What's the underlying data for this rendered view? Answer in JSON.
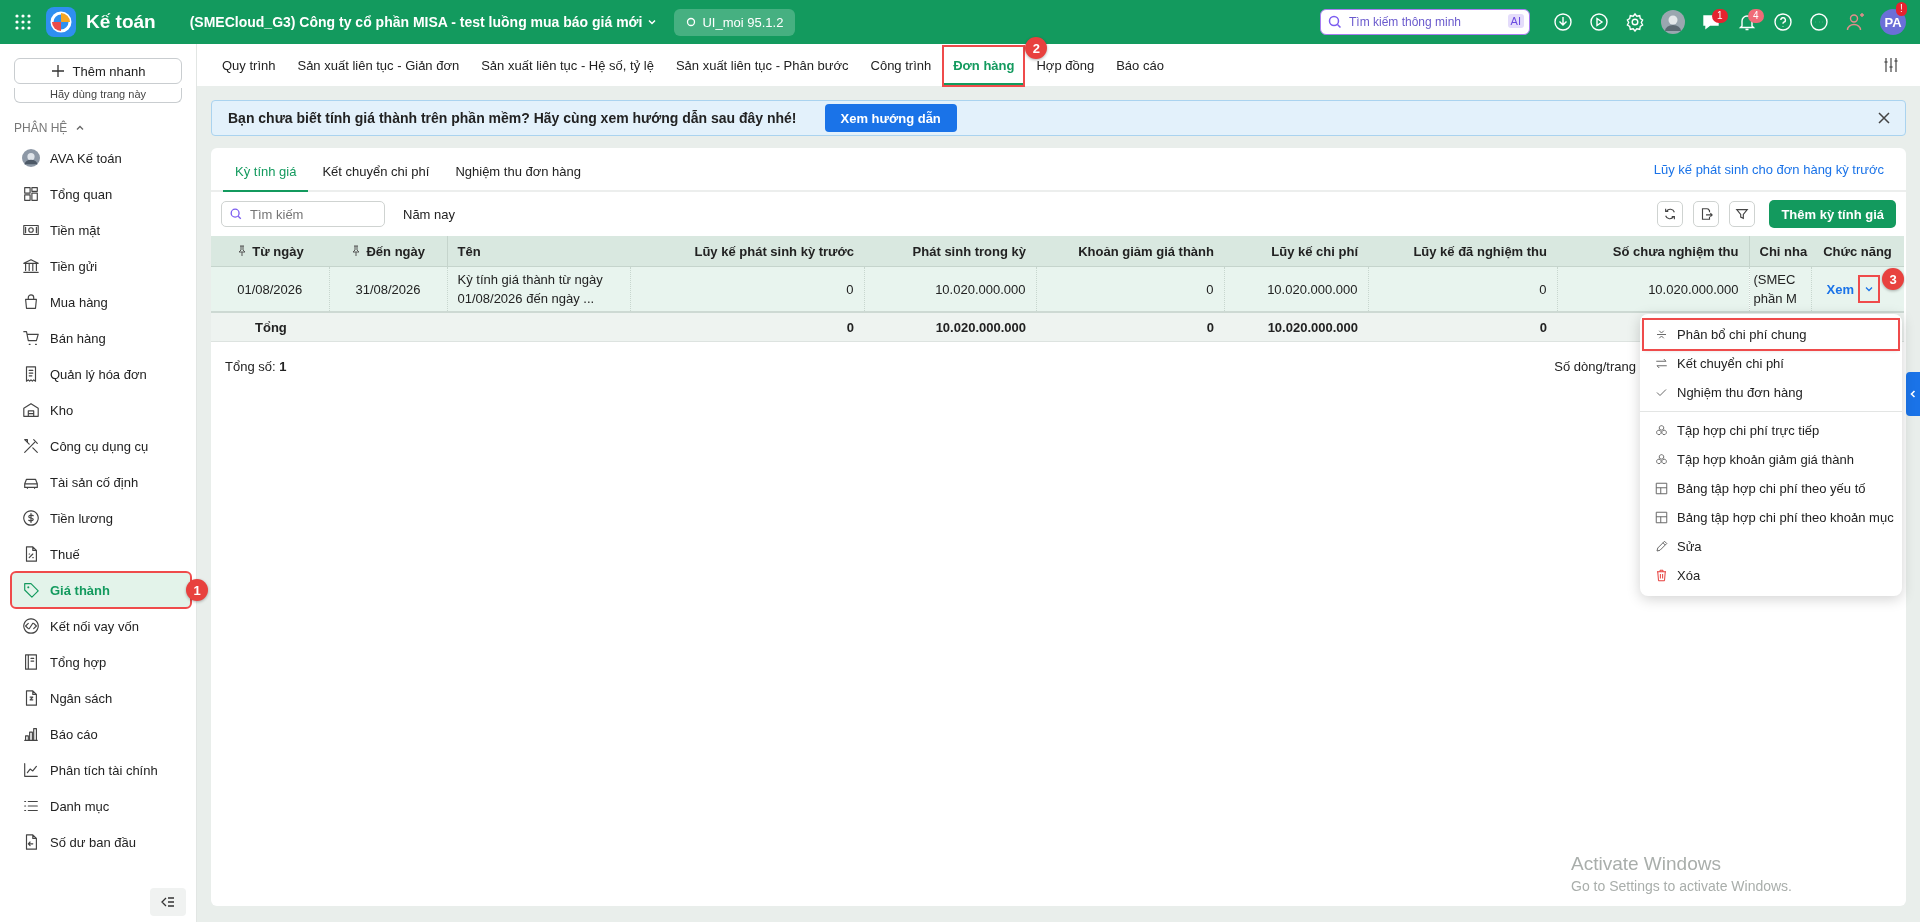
{
  "topbar": {
    "app_name": "Kế toán",
    "company": "(SMECloud_G3) Công ty cổ phần MISA - test luồng mua báo giá mới",
    "version": "UI_moi 95.1.2",
    "search": {
      "placeholder": "Tìm kiếm thông minh",
      "badge": "AI"
    },
    "chat_count": "1",
    "notification_count": "4",
    "user_initials": "PA",
    "user_alert": "!"
  },
  "sidebar": {
    "quick_add": "Thêm nhanh",
    "hint_card": "Hãy dùng trang này",
    "section": {
      "label": "PHÂN HỆ",
      "expanded": true
    },
    "items": [
      {
        "label": "AVA Kế toán",
        "selected": false
      },
      {
        "label": "Tổng quan",
        "selected": false
      },
      {
        "label": "Tiền mặt",
        "selected": false
      },
      {
        "label": "Tiền gửi",
        "selected": false
      },
      {
        "label": "Mua hàng",
        "selected": false
      },
      {
        "label": "Bán hàng",
        "selected": false
      },
      {
        "label": "Quản lý hóa đơn",
        "selected": false
      },
      {
        "label": "Kho",
        "selected": false
      },
      {
        "label": "Công cụ dụng cụ",
        "selected": false
      },
      {
        "label": "Tài sản cố định",
        "selected": false
      },
      {
        "label": "Tiền lương",
        "selected": false
      },
      {
        "label": "Thuế",
        "selected": false
      },
      {
        "label": "Giá thành",
        "selected": true,
        "highlighted": true,
        "callout": "1"
      },
      {
        "label": "Kết nối vay vốn",
        "selected": false
      },
      {
        "label": "Tổng hợp",
        "selected": false
      },
      {
        "label": "Ngân sách",
        "selected": false
      },
      {
        "label": "Báo cáo",
        "selected": false
      },
      {
        "label": "Phân tích tài chính",
        "selected": false
      },
      {
        "label": "Danh mục",
        "selected": false
      },
      {
        "label": "Số dư ban đầu",
        "selected": false
      }
    ]
  },
  "tabs": [
    {
      "label": "Quy trình",
      "selected": false
    },
    {
      "label": "Sản xuất liên tục - Giản đơn",
      "selected": false
    },
    {
      "label": "Sản xuất liên tục - Hệ số, tỷ lệ",
      "selected": false
    },
    {
      "label": "Sản xuất liên tục - Phân bước",
      "selected": false
    },
    {
      "label": "Công trình",
      "selected": false
    },
    {
      "label": "Đơn hàng",
      "selected": true,
      "highlighted": true,
      "callout": "2"
    },
    {
      "label": "Hợp đồng",
      "selected": false
    },
    {
      "label": "Báo cáo",
      "selected": false
    }
  ],
  "banner": {
    "text": "Bạn chưa biết tính giá thành trên phần mềm? Hãy cùng xem hướng dẫn sau đây nhé!",
    "button": "Xem hướng dẫn"
  },
  "subtabs": [
    {
      "label": "Kỳ tính giá",
      "selected": true
    },
    {
      "label": "Kết chuyển chi phí",
      "selected": false
    },
    {
      "label": "Nghiệm thu đơn hàng",
      "selected": false
    }
  ],
  "prior_link": "Lũy kế phát sinh cho đơn hàng kỳ trước",
  "toolbar": {
    "search_placeholder": "Tìm kiếm",
    "period": "Năm nay",
    "add_button": "Thêm kỳ tính giá"
  },
  "table": {
    "columns": [
      {
        "label": "Từ ngày",
        "kind": "date",
        "pinned": true
      },
      {
        "label": "Đến ngày",
        "kind": "date",
        "pinned": true
      },
      {
        "label": "Tên",
        "kind": "text",
        "pinned": false
      },
      {
        "label": "Lũy kế phát sinh kỳ trước",
        "kind": "number",
        "pinned": false
      },
      {
        "label": "Phát sinh trong kỳ",
        "kind": "number",
        "pinned": false
      },
      {
        "label": "Khoản giảm giá thành",
        "kind": "number",
        "pinned": false
      },
      {
        "label": "Lũy kế chi phí",
        "kind": "number",
        "pinned": false
      },
      {
        "label": "Lũy kế đã nghiệm thu",
        "kind": "number",
        "pinned": false
      },
      {
        "label": "Số chưa nghiệm thu",
        "kind": "number",
        "pinned": false
      },
      {
        "label": "Chi nha",
        "kind": "text",
        "pinned": false
      },
      {
        "label": "Chức năng",
        "kind": "action",
        "pinned": false
      }
    ],
    "rows": [
      {
        "selected": true,
        "cells": [
          "01/08/2026",
          "31/08/2026",
          "Kỳ tính giá thành từ ngày 01/08/2026 đến ngày ...",
          "0",
          "10.020.000.000",
          "0",
          "10.020.000.000",
          "0",
          "10.020.000.000",
          "(SMEC phần M"
        ],
        "action": {
          "label": "Xem",
          "highlighted": true,
          "callout": "3"
        }
      }
    ],
    "footer": {
      "label": "Tổng",
      "cells": [
        "0",
        "10.020.000.000",
        "0",
        "10.020.000.000",
        "0"
      ]
    },
    "total_label": "Tổng số:",
    "total_value": "1",
    "page_size_label": "Số dòng/trang"
  },
  "row_menu": {
    "groups": [
      [
        {
          "label": "Phân bổ chi phí chung",
          "highlighted": true
        },
        {
          "label": "Kết chuyển chi phí",
          "highlighted": false
        },
        {
          "label": "Nghiệm thu đơn hàng",
          "highlighted": false
        }
      ],
      [
        {
          "label": "Tập hợp chi phí trực tiếp",
          "highlighted": false
        },
        {
          "label": "Tập hợp khoản giảm giá thành",
          "highlighted": false
        },
        {
          "label": "Bảng tập hợp chi phí theo yếu tố",
          "highlighted": false
        },
        {
          "label": "Bảng tập hợp chi phí theo khoản mục",
          "highlighted": false
        },
        {
          "label": "Sửa",
          "highlighted": false
        },
        {
          "label": "Xóa",
          "highlighted": false
        }
      ]
    ]
  },
  "os_notice": {
    "title": "Activate Windows",
    "text": "Go to Settings to activate Windows."
  }
}
